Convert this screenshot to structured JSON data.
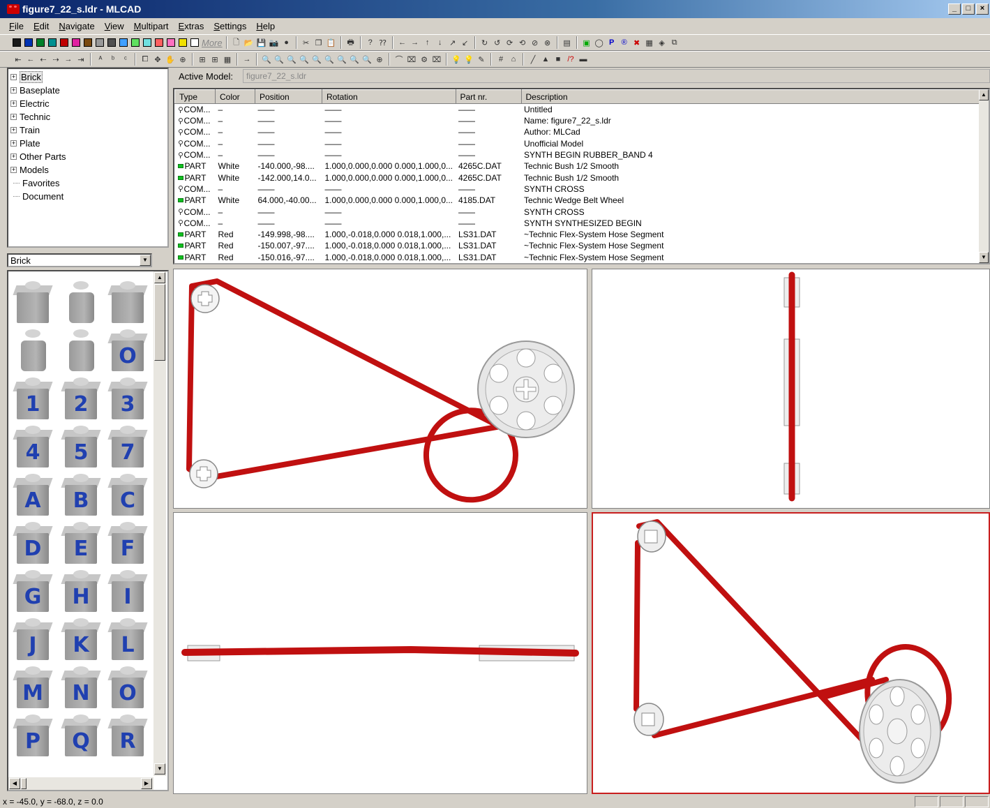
{
  "window": {
    "title": "figure7_22_s.ldr - MLCAD",
    "controls": [
      "_",
      "□",
      "×"
    ]
  },
  "menu": [
    "File",
    "Edit",
    "Navigate",
    "View",
    "Multipart",
    "Extras",
    "Settings",
    "Help"
  ],
  "toolbar": {
    "color_swatches": [
      "#1a1a1a",
      "#0033b2",
      "#00802a",
      "#009090",
      "#c00000",
      "#e020a0",
      "#7a4a10",
      "#999999",
      "#505050",
      "#40a0ff",
      "#60e060",
      "#70e0e0",
      "#ff6060",
      "#ff70c0",
      "#f0e000",
      "#ffffff"
    ],
    "more_label": "More"
  },
  "tree": {
    "items": [
      {
        "label": "Brick",
        "expandable": true,
        "selected": true
      },
      {
        "label": "Baseplate",
        "expandable": true
      },
      {
        "label": "Electric",
        "expandable": true
      },
      {
        "label": "Technic",
        "expandable": true
      },
      {
        "label": "Train",
        "expandable": true
      },
      {
        "label": "Plate",
        "expandable": true
      },
      {
        "label": "Other Parts",
        "expandable": true
      },
      {
        "label": "Models",
        "expandable": true
      },
      {
        "label": "Favorites",
        "expandable": false
      },
      {
        "label": "Document",
        "expandable": false
      }
    ]
  },
  "part_combo": {
    "value": "Brick"
  },
  "palette": {
    "glyphs": [
      "",
      "",
      "",
      "",
      "",
      "O",
      "1",
      "2",
      "3",
      "4",
      "5",
      "7",
      "A",
      "B",
      "C",
      "D",
      "E",
      "F",
      "G",
      "H",
      "I",
      "J",
      "K",
      "L",
      "M",
      "N",
      "O",
      "P",
      "Q",
      "R"
    ]
  },
  "active_model": {
    "label": "Active Model:",
    "value": "figure7_22_s.ldr"
  },
  "model_list": {
    "columns": [
      "Type",
      "Color",
      "Position",
      "Rotation",
      "Part nr.",
      "Description"
    ],
    "rows": [
      {
        "type": "COM...",
        "icon": "com",
        "color": "–",
        "position": "——",
        "rotation": "——",
        "part": "——",
        "description": "Untitled"
      },
      {
        "type": "COM...",
        "icon": "com",
        "color": "–",
        "position": "——",
        "rotation": "——",
        "part": "——",
        "description": "Name: figure7_22_s.ldr"
      },
      {
        "type": "COM...",
        "icon": "com",
        "color": "–",
        "position": "——",
        "rotation": "——",
        "part": "——",
        "description": "Author: MLCad"
      },
      {
        "type": "COM...",
        "icon": "com",
        "color": "–",
        "position": "——",
        "rotation": "——",
        "part": "——",
        "description": "Unofficial Model"
      },
      {
        "type": "COM...",
        "icon": "com",
        "color": "–",
        "position": "——",
        "rotation": "——",
        "part": "——",
        "description": "SYNTH BEGIN RUBBER_BAND 4"
      },
      {
        "type": "PART",
        "icon": "part",
        "color": "White",
        "position": "-140.000,-98....",
        "rotation": "1.000,0.000,0.000 0.000,1.000,0...",
        "part": "4265C.DAT",
        "description": "Technic Bush 1/2 Smooth"
      },
      {
        "type": "PART",
        "icon": "part",
        "color": "White",
        "position": "-142.000,14.0...",
        "rotation": "1.000,0.000,0.000 0.000,1.000,0...",
        "part": "4265C.DAT",
        "description": "Technic Bush 1/2 Smooth"
      },
      {
        "type": "COM...",
        "icon": "com",
        "color": "–",
        "position": "——",
        "rotation": "——",
        "part": "——",
        "description": "SYNTH CROSS"
      },
      {
        "type": "PART",
        "icon": "part",
        "color": "White",
        "position": "64.000,-40.00...",
        "rotation": "1.000,0.000,0.000 0.000,1.000,0...",
        "part": "4185.DAT",
        "description": "Technic Wedge Belt Wheel"
      },
      {
        "type": "COM...",
        "icon": "com",
        "color": "–",
        "position": "——",
        "rotation": "——",
        "part": "——",
        "description": "SYNTH CROSS"
      },
      {
        "type": "COM...",
        "icon": "com",
        "color": "–",
        "position": "——",
        "rotation": "——",
        "part": "——",
        "description": "SYNTH SYNTHESIZED BEGIN"
      },
      {
        "type": "PART",
        "icon": "part",
        "color": "Red",
        "position": "-149.998,-98....",
        "rotation": "1.000,-0.018,0.000 0.018,1.000,...",
        "part": "LS31.DAT",
        "description": "~Technic Flex-System Hose Segment"
      },
      {
        "type": "PART",
        "icon": "part",
        "color": "Red",
        "position": "-150.007,-97....",
        "rotation": "1.000,-0.018,0.000 0.018,1.000,...",
        "part": "LS31.DAT",
        "description": "~Technic Flex-System Hose Segment"
      },
      {
        "type": "PART",
        "icon": "part",
        "color": "Red",
        "position": "-150.016,-97....",
        "rotation": "1.000,-0.018,0.000 0.018,1.000,...",
        "part": "LS31.DAT",
        "description": "~Technic Flex-System Hose Segment"
      }
    ]
  },
  "colors": {
    "band_red": "#c01010",
    "active_viewport_border": "#c81e1e"
  },
  "status": {
    "coords": "x = -45.0, y = -68.0, z = 0.0"
  }
}
